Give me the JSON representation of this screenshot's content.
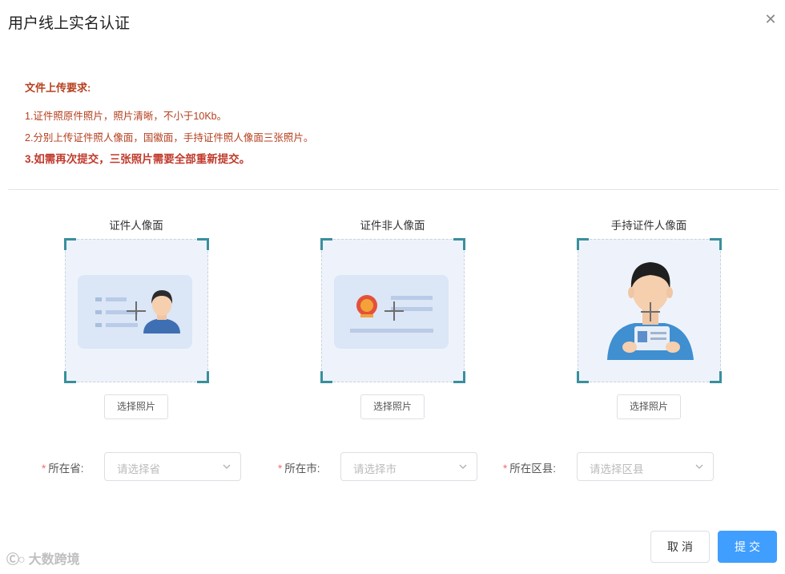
{
  "dialog": {
    "title": "用户线上实名认证"
  },
  "requirements": {
    "title": "文件上传要求:",
    "items": [
      "1.证件照原件照片，照片清晰，不小于10Kb。",
      "2.分别上传证件照人像面，国徽面，手持证件照人像面三张照片。",
      "3.如需再次提交，三张照片需要全部重新提交。"
    ]
  },
  "uploads": [
    {
      "title": "证件人像面",
      "button": "选择照片"
    },
    {
      "title": "证件非人像面",
      "button": "选择照片"
    },
    {
      "title": "手持证件人像面",
      "button": "选择照片"
    }
  ],
  "location": {
    "province": {
      "label": "所在省:",
      "placeholder": "请选择省"
    },
    "city": {
      "label": "所在市:",
      "placeholder": "请选择市"
    },
    "district": {
      "label": "所在区县:",
      "placeholder": "请选择区县"
    }
  },
  "footer": {
    "cancel_label": "取消",
    "submit_label": "提交"
  },
  "watermark": {
    "text": "大数跨境"
  },
  "colors": {
    "accent": "#409eff",
    "requirement_text": "#b5401f",
    "frame_corner": "#3a8f9c",
    "required_star": "#f56c6c"
  }
}
